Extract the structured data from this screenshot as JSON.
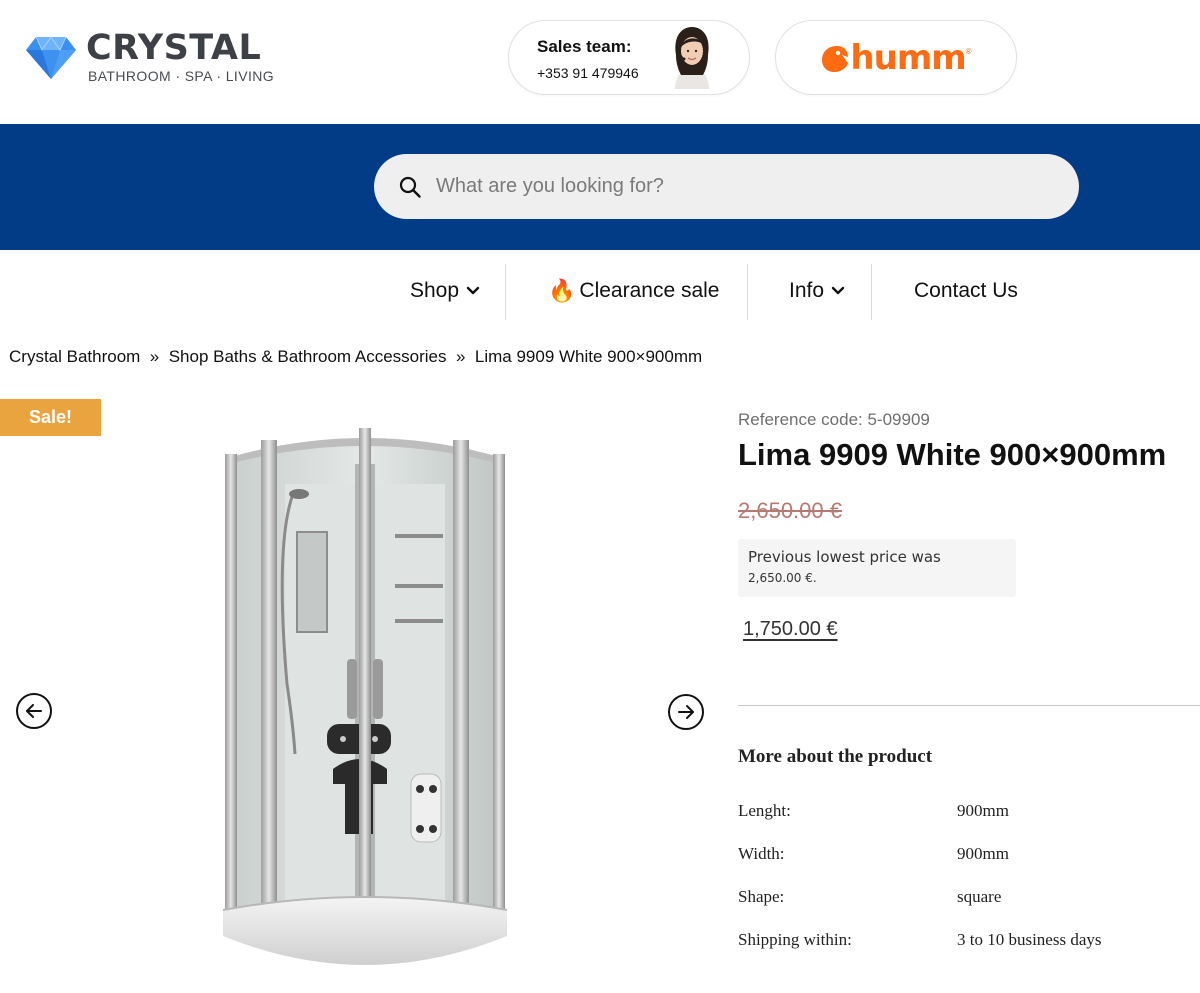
{
  "brand": {
    "name": "CRYSTAL",
    "tagline": "BATHROOM · SPA · LIVING",
    "gem_color": "#3a8ff0"
  },
  "sales": {
    "title": "Sales team:",
    "phone": "+353 91 479946"
  },
  "partner": {
    "name": "humm",
    "registered": "®",
    "color": "#ff6b10"
  },
  "search": {
    "placeholder": "What are you looking for?",
    "value": ""
  },
  "nav": {
    "shop": "Shop",
    "clearance": "Clearance sale",
    "clearance_emoji": "🔥",
    "info": "Info",
    "contact": "Contact Us"
  },
  "breadcrumb": {
    "items": [
      "Crystal Bathroom",
      "Shop Baths & Bathroom Accessories",
      "Lima 9909 White 900×900mm"
    ],
    "separator": "»"
  },
  "product": {
    "badge": "Sale!",
    "reference_code": "Reference code: 5-09909",
    "title": "Lima 9909 White 900×900mm",
    "old_price": "2,650.00 €",
    "lowest_price_text": "Previous lowest price was",
    "lowest_price_value": "2,650.00 €.",
    "price": "1,750.00 €"
  },
  "more_about": {
    "title": "More about the product",
    "specs": [
      {
        "label": "Lenght:",
        "value": "900mm"
      },
      {
        "label": "Width:",
        "value": "900mm"
      },
      {
        "label": "Shape:",
        "value": "square"
      },
      {
        "label": "Shipping within:",
        "value": "3 to 10 business days"
      }
    ]
  },
  "colors": {
    "band": "#033c86",
    "sale_badge": "#e9a43f",
    "old_price": "#b57a73"
  }
}
